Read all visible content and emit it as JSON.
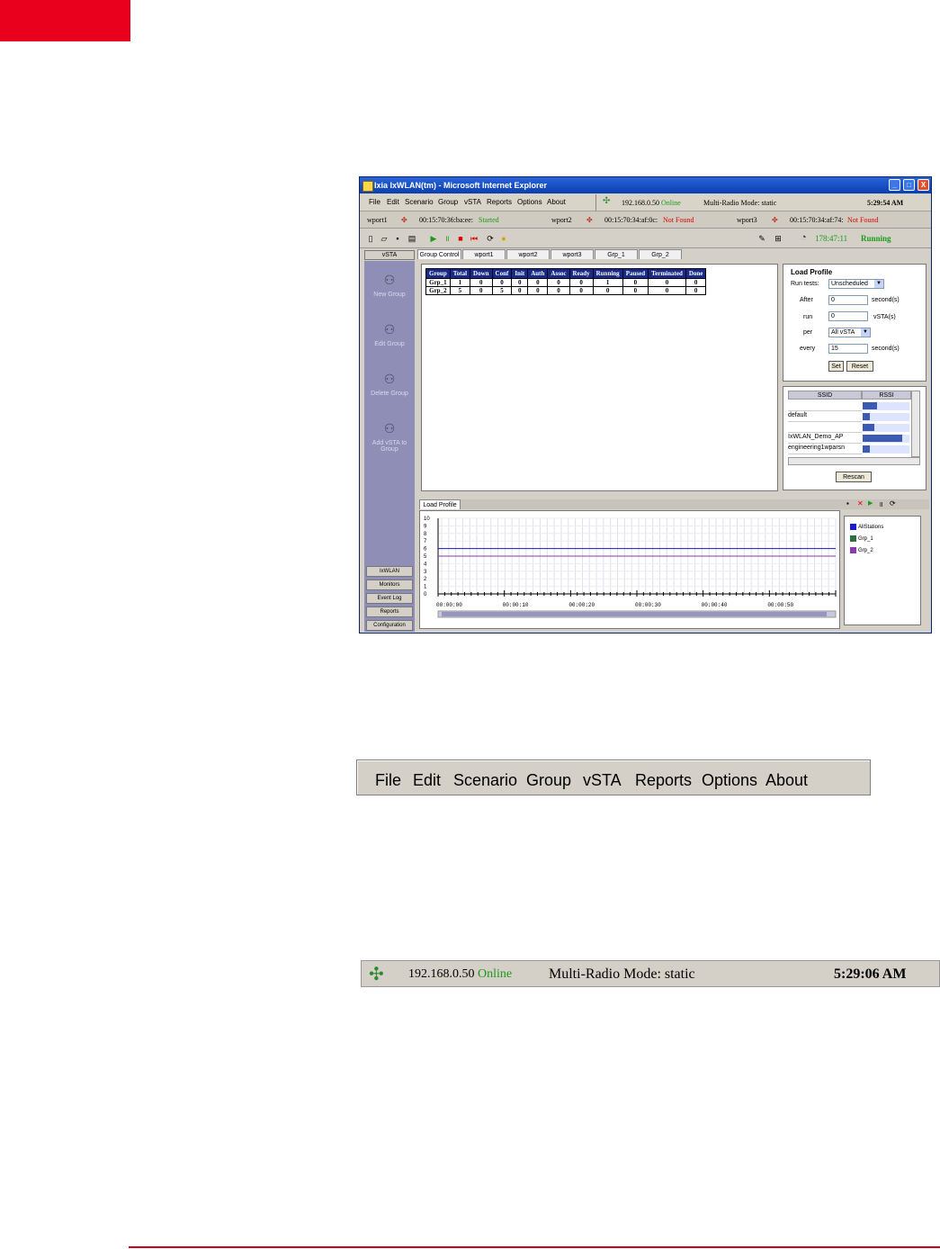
{
  "window": {
    "title": "Ixia IxWLAN(tm) - Microsoft Internet Explorer",
    "controls": [
      "_",
      "□",
      "X"
    ]
  },
  "menu": [
    "File",
    "Edit",
    "Scenario",
    "Group",
    "vSTA",
    "Reports",
    "Options",
    "About"
  ],
  "status": {
    "ip": "192.168.0.50",
    "state": "Online",
    "mode": "Multi-Radio Mode: static",
    "time": "5:29:54 AM"
  },
  "wports": [
    {
      "name": "wport1",
      "mac": "00:15:70:36:ba:ee:",
      "state": "Started"
    },
    {
      "name": "wport2",
      "mac": "00:15:70:34:af:0c:",
      "state": "Not Found"
    },
    {
      "name": "wport3",
      "mac": "00:15:70:34:af:74:",
      "state": "Not Found"
    }
  ],
  "runtime": {
    "elapsed": "178:47:11",
    "state": "Running"
  },
  "sidebar": {
    "header": "vSTA",
    "items": [
      "New Group",
      "Edit Group",
      "Delete Group",
      "Add vSTA to Group"
    ],
    "buttons": [
      "IxWLAN",
      "Monitors",
      "Event Log",
      "Reports",
      "Configuration"
    ]
  },
  "tabs": [
    "Group Control",
    "wport1",
    "wport2",
    "wport3",
    "Grp_1",
    "Grp_2"
  ],
  "group_table": {
    "columns": [
      "Group",
      "Total",
      "Down",
      "Conf",
      "Init",
      "Auth",
      "Assoc",
      "Ready",
      "Running",
      "Paused",
      "Terminated",
      "Done"
    ],
    "rows": [
      [
        "Grp_1",
        "1",
        "0",
        "0",
        "0",
        "0",
        "0",
        "0",
        "1",
        "0",
        "0",
        "0"
      ],
      [
        "Grp_2",
        "5",
        "0",
        "5",
        "0",
        "0",
        "0",
        "0",
        "0",
        "0",
        "0",
        "0"
      ]
    ]
  },
  "load_profile": {
    "title": "Load Profile",
    "run_tests_label": "Run tests:",
    "run_tests_value": "Unscheduled",
    "after_label": "After",
    "after_value": "0",
    "after_unit": "second(s)",
    "run_label": "run",
    "run_value": "0",
    "run_unit": "vSTA(s)",
    "per_label": "per",
    "per_value": "All vSTA",
    "every_label": "every",
    "every_value": "15",
    "every_unit": "second(s)",
    "set_button": "Set",
    "reset_button": "Reset"
  },
  "ssid_list": {
    "headers": [
      "SSID",
      "RSSI"
    ],
    "rows": [
      {
        "ssid": "",
        "rssi_fraction": 0.3
      },
      {
        "ssid": "default",
        "rssi_fraction": 0.15
      },
      {
        "ssid": "",
        "rssi_fraction": 0.25
      },
      {
        "ssid": "IxWLAN_Demo_AP",
        "rssi_fraction": 0.85
      },
      {
        "ssid": "engineering1wparsn",
        "rssi_fraction": 0.15
      }
    ],
    "rescan_button": "Rescan"
  },
  "graph": {
    "tab": "Load Profile",
    "y_ticks": [
      "10",
      "9",
      "8",
      "7",
      "6",
      "5",
      "4",
      "3",
      "2",
      "1",
      "0"
    ],
    "x_ticks": [
      "00:00:00",
      "00:00:10",
      "00:00:20",
      "00:00:30",
      "00:00:40",
      "00:00:50"
    ],
    "legend": [
      {
        "name": "AllStations",
        "color": "#1a1acc"
      },
      {
        "name": "Grp_1",
        "color": "#2f6f3f"
      },
      {
        "name": "Grp_2",
        "color": "#8a3ab0"
      }
    ],
    "series_levels": {
      "AllStations": 6,
      "Grp_2": 5
    }
  },
  "zoom_menu": [
    "File",
    "Edit",
    "Scenario",
    "Group",
    "vSTA",
    "Reports",
    "Options",
    "About"
  ],
  "zoom_status": {
    "ip": "192.168.0.50",
    "state": "Online",
    "mode": "Multi-Radio Mode: static",
    "time": "5:29:06 AM"
  },
  "colors": {
    "brand_red": "#e8001c",
    "sidebar": "#8f8eb6",
    "table_header": "#1a2a8a",
    "online": "#1a9a1a",
    "not_found": "#e00000"
  }
}
